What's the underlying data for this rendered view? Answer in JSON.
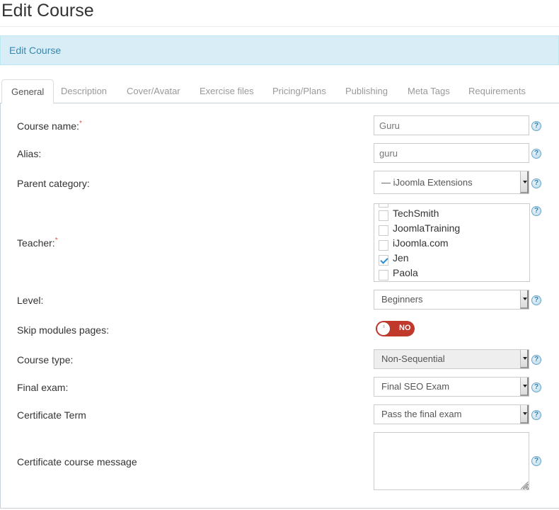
{
  "page": {
    "title": "Edit Course",
    "info_bar": "Edit Course"
  },
  "tabs": [
    {
      "label": "General",
      "active": true
    },
    {
      "label": "Description",
      "active": false
    },
    {
      "label": "Cover/Avatar",
      "active": false
    },
    {
      "label": "Exercise files",
      "active": false
    },
    {
      "label": "Pricing/Plans",
      "active": false
    },
    {
      "label": "Publishing",
      "active": false
    },
    {
      "label": "Meta Tags",
      "active": false
    },
    {
      "label": "Requirements",
      "active": false
    }
  ],
  "form": {
    "required_mark": "*",
    "help_glyph": "?",
    "course_name": {
      "label": "Course name:",
      "value": "Guru"
    },
    "alias": {
      "label": "Alias:",
      "value": "guru"
    },
    "parent_category": {
      "label": "Parent category:",
      "value": "— iJoomla Extensions"
    },
    "teacher": {
      "label": "Teacher:",
      "options": [
        {
          "name": "TechSmith",
          "checked": false
        },
        {
          "name": "JoomlaTraining",
          "checked": false
        },
        {
          "name": "iJoomla.com",
          "checked": false
        },
        {
          "name": "Jen",
          "checked": true
        },
        {
          "name": "Paola",
          "checked": false
        }
      ]
    },
    "level": {
      "label": "Level:",
      "value": "Beginners"
    },
    "skip_modules": {
      "label": "Skip modules pages:",
      "state": "NO",
      "color": "#c0392b"
    },
    "course_type": {
      "label": "Course type:",
      "value": "Non-Sequential",
      "disabled": true
    },
    "final_exam": {
      "label": "Final exam:",
      "value": "Final SEO Exam"
    },
    "certificate_term": {
      "label": "Certificate Term",
      "value": "Pass the final exam"
    },
    "certificate_message": {
      "label": "Certificate course message",
      "value": ""
    }
  }
}
